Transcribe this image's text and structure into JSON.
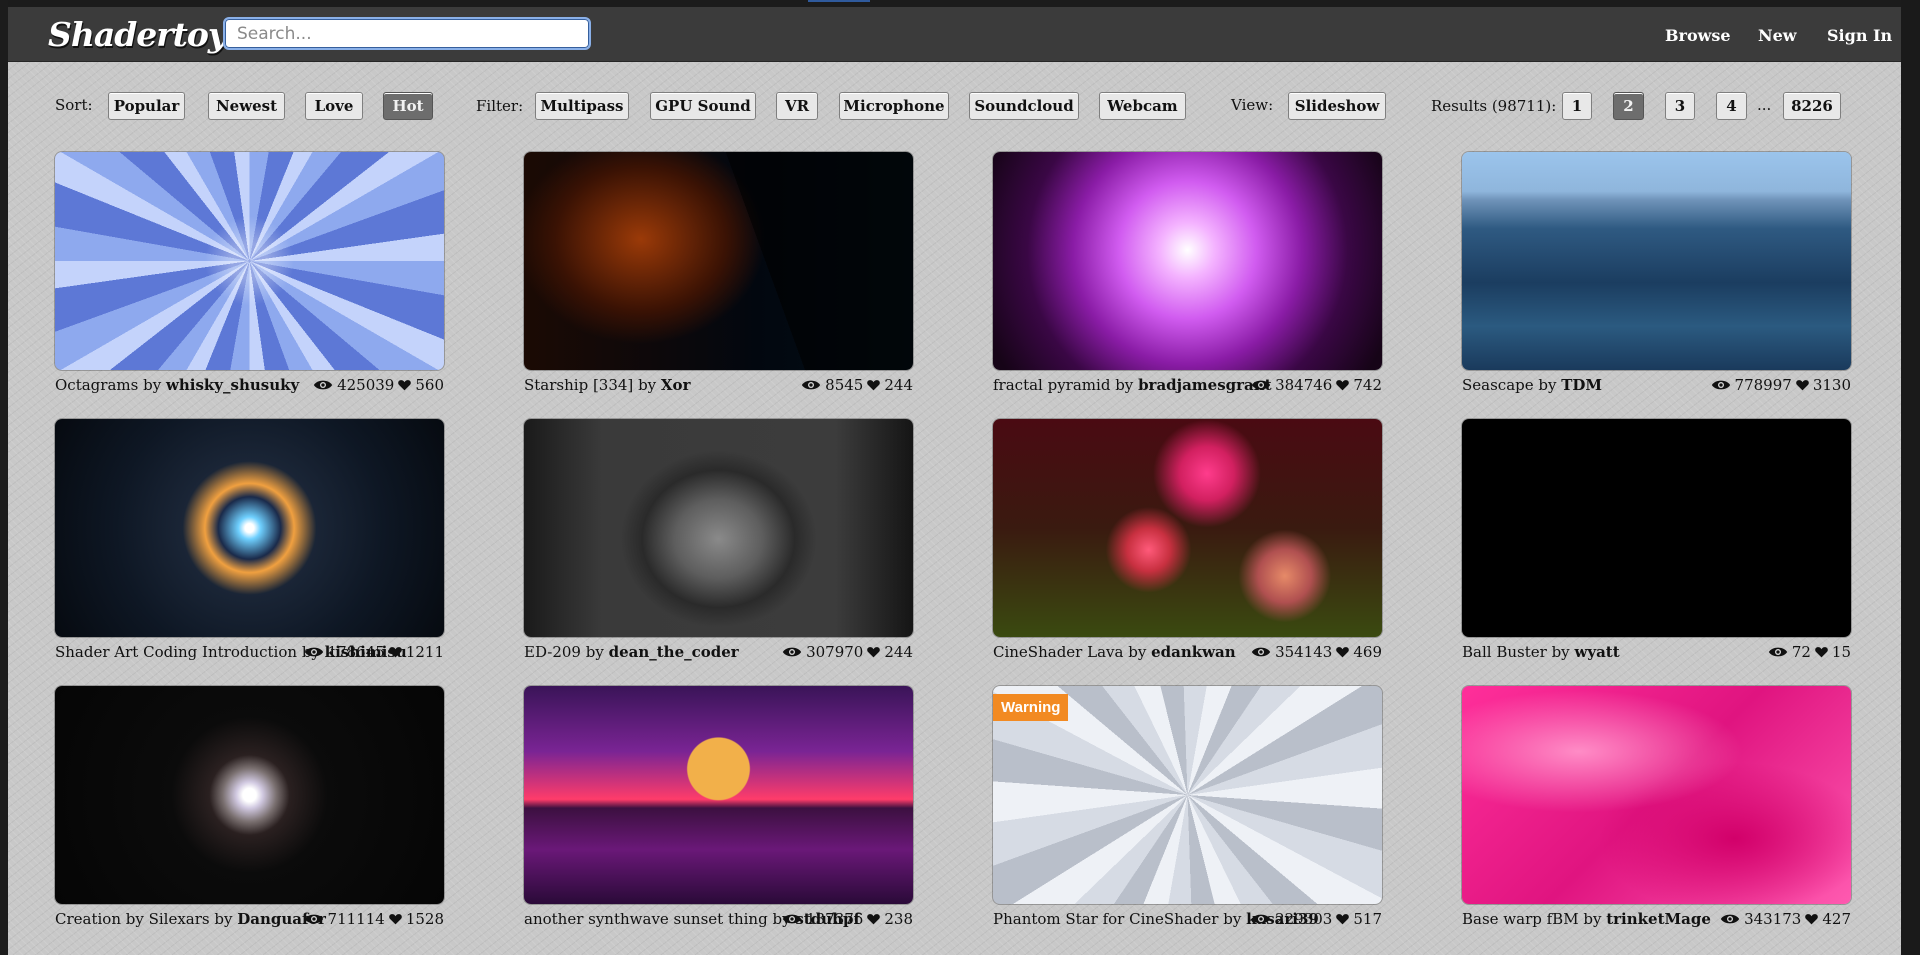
{
  "header": {
    "logo": "Shadertoy",
    "search_placeholder": "Search...",
    "nav": [
      "Browse",
      "New",
      "Sign In"
    ]
  },
  "toolbar": {
    "sort_label": "Sort:",
    "sort_options": [
      "Popular",
      "Newest",
      "Love",
      "Hot"
    ],
    "sort_active": "Hot",
    "filter_label": "Filter:",
    "filters": [
      "Multipass",
      "GPU Sound",
      "VR",
      "Microphone",
      "Soundcloud",
      "Webcam"
    ],
    "view_label": "View:",
    "view_option": "Slideshow",
    "results_label": "Results (98711):",
    "pages": [
      "1",
      "2",
      "3",
      "4"
    ],
    "page_active": "2",
    "ellipsis": "...",
    "last_page": "8226"
  },
  "shaders": [
    {
      "title": "Octagrams",
      "by": "by",
      "author": "whisky_shusuky",
      "views": "425039",
      "likes": "560"
    },
    {
      "title": "Starship [334]",
      "by": "by",
      "author": "Xor",
      "views": "8545",
      "likes": "244"
    },
    {
      "title": "fractal pyramid",
      "by": "by",
      "author": "bradjamesgrant",
      "views": "384746",
      "likes": "742"
    },
    {
      "title": "Seascape",
      "by": "by",
      "author": "TDM",
      "views": "778997",
      "likes": "3130"
    },
    {
      "title": "Shader Art Coding Introduction",
      "by": "by",
      "author": "kishimisu",
      "views": "178645",
      "likes": "1211"
    },
    {
      "title": "ED-209",
      "by": "by",
      "author": "dean_the_coder",
      "views": "307970",
      "likes": "244"
    },
    {
      "title": "CineShader Lava",
      "by": "by",
      "author": "edankwan",
      "views": "354143",
      "likes": "469"
    },
    {
      "title": "Ball Buster",
      "by": "by",
      "author": "wyatt",
      "views": "72",
      "likes": "15"
    },
    {
      "title": "Creation by Silexars",
      "by": "by",
      "author": "Danguafer",
      "views": "711114",
      "likes": "1528"
    },
    {
      "title": "another synthwave sunset thing",
      "by": "by",
      "author": "stduhpf",
      "views": "137376",
      "likes": "238"
    },
    {
      "title": "Phantom Star for CineShader",
      "by": "by",
      "author": "kasari39",
      "views": "229303",
      "likes": "517",
      "badge": "Warning"
    },
    {
      "title": "Base warp fBM",
      "by": "by",
      "author": "trinketMage",
      "views": "343173",
      "likes": "427"
    }
  ],
  "colors": {
    "header_bg": "#3b3b3b",
    "page_bg": "#c8c8c8",
    "active_button": "#6d6d6d",
    "warning": "#f28a22",
    "search_focus": "#8ab0e8"
  },
  "icons": [
    "eye-icon",
    "heart-icon"
  ]
}
